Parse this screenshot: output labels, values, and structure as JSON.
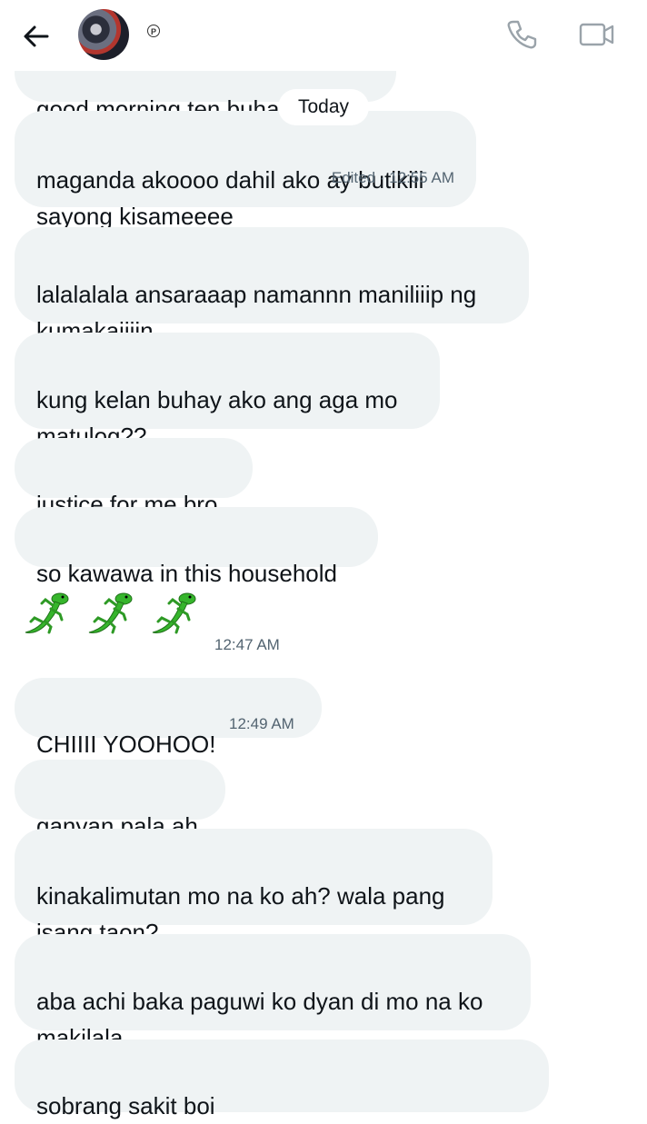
{
  "header": {
    "badge_glyph": "P",
    "icons": [
      "back-arrow-icon",
      "avatar",
      "verified-badge-icon",
      "phone-icon",
      "video-camera-icon"
    ]
  },
  "divider": {
    "label": "Today"
  },
  "messages": [
    {
      "text": "good morning ten buhay na ko"
    },
    {
      "text": "maganda akoooo dahil ako ay butikiii\nsayong kisameeee",
      "meta": "Edited · 12:55 AM"
    },
    {
      "text": "lalalalala ansaraaap namannn maniliiip ng\nkumakaiiiin"
    },
    {
      "text": "kung kelan buhay ako ang aga mo\nmatulog??"
    },
    {
      "text": "justice for me bro"
    },
    {
      "text": "so kawawa in this household"
    },
    {
      "emoji": "🦎🦎🦎",
      "time": "12:47 AM"
    },
    {
      "text": "CHIIII YOOHOO!",
      "time": "12:49 AM"
    },
    {
      "text": "ganyan pala ah"
    },
    {
      "text": "kinakalimutan mo na ko ah? wala pang\nisang taon?"
    },
    {
      "text": "aba achi baka paguwi ko dyan di mo na ko\nmakilala"
    },
    {
      "text": "sobrang sakit boi"
    }
  ],
  "colors": {
    "bubble": "#eff3f4",
    "text": "#0f1419",
    "muted": "#536471",
    "icon": "#9aa3aa",
    "gecko": "#36b52c"
  }
}
